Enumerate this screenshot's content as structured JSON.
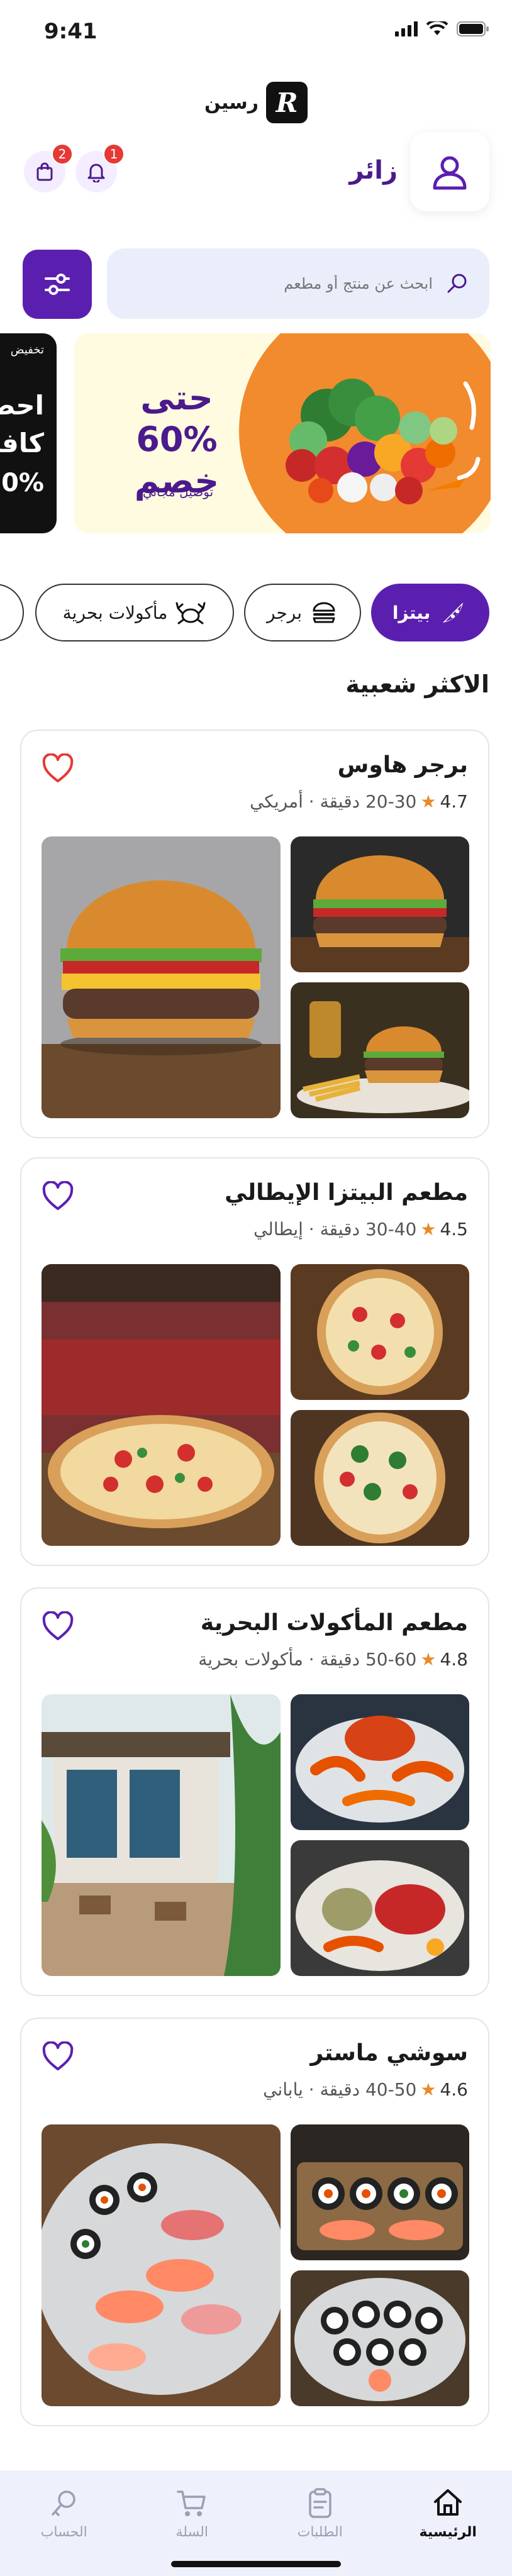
{
  "status_bar": {
    "time": "9:41"
  },
  "app": {
    "logo_text": "رسين",
    "logo_letter": "R"
  },
  "header": {
    "user_name": "زائر",
    "cart_badge": "2",
    "notif_badge": "1"
  },
  "search": {
    "placeholder": "ابحث عن منتج أو مطعم"
  },
  "banner": {
    "title_line1": "حتى",
    "title_line2": "60% خصم",
    "subtitle": "توصيل مجاني",
    "side_small": "تخفيض",
    "side_line1": "احصل",
    "side_line2": "كافة",
    "side_line3": "0%"
  },
  "categories": [
    {
      "label": "بيتزا",
      "icon": "pizza-icon",
      "active": true
    },
    {
      "label": "برجر",
      "icon": "burger-icon",
      "active": false
    },
    {
      "label": "مأكولات بحرية",
      "icon": "crab-icon",
      "active": false
    }
  ],
  "section": {
    "title": "الاكثر شعبية"
  },
  "restaurants": [
    {
      "name": "برجر هاوس",
      "rating": "4.7",
      "meta": "20-30 دقيقة · أمريكي",
      "favorited": true
    },
    {
      "name": "مطعم البيتزا الإيطالي",
      "rating": "4.5",
      "meta": "30-40 دقيقة · إيطالي",
      "favorited": false
    },
    {
      "name": "مطعم المأكولات البحرية",
      "rating": "4.8",
      "meta": "50-60 دقيقة · مأكولات بحرية",
      "favorited": false
    },
    {
      "name": "سوشي ماستر",
      "rating": "4.6",
      "meta": "40-50 دقيقة · ياباني",
      "favorited": false
    }
  ],
  "bottom_nav": [
    {
      "label": "الرئيسية",
      "icon": "home-icon",
      "active": true
    },
    {
      "label": "الطلبات",
      "icon": "orders-icon",
      "active": false
    },
    {
      "label": "السلة",
      "icon": "cart-icon",
      "active": false
    },
    {
      "label": "الحساب",
      "icon": "account-icon",
      "active": false
    }
  ],
  "colors": {
    "primary": "#5b1fb0",
    "accent_orange": "#f28a2e",
    "banner_bg": "#fffbe0",
    "heart_red": "#e53935",
    "star": "#e8892a"
  }
}
